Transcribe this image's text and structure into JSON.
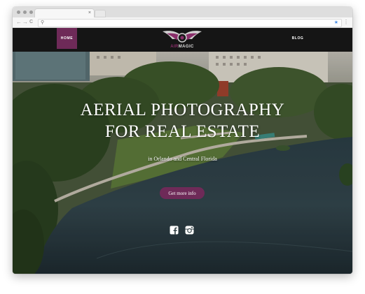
{
  "browser": {
    "tab_close_glyph": "×",
    "back_glyph": "←",
    "forward_glyph": "→",
    "reload_glyph": "C",
    "search_glyph": "⚲",
    "star_glyph": "★",
    "menu_glyph": "⋮"
  },
  "site": {
    "nav": {
      "home_label": "HOME",
      "blog_label": "BLOG"
    },
    "logo": {
      "word_part_1": "AIR",
      "word_part_2": "MAGIC"
    },
    "hero": {
      "headline_line_1": "AERIAL PHOTOGRAPHY",
      "headline_line_2": "FOR REAL ESTATE",
      "subtitle": "in Orlando and Central Florida",
      "cta_label": "Get more info"
    },
    "social": {
      "facebook_icon": "facebook-icon",
      "instagram_icon": "instagram-icon"
    }
  },
  "colors": {
    "brand_accent": "#6e2a58",
    "nav_background": "#151515"
  }
}
